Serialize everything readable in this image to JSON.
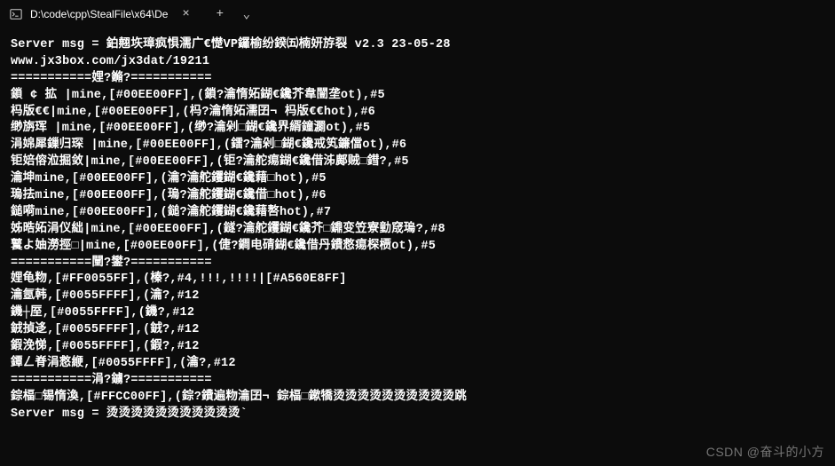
{
  "tab": {
    "title": "D:\\code\\cpp\\StealFile\\x64\\De",
    "close_glyph": "×",
    "add_glyph": "+",
    "dropdown_glyph": "⌄"
  },
  "terminal": {
    "lines": [
      "Server msg = 鉑翹垁璋疯惧濡广€憷VP鑼榆纷鍨㈤楠妍斿裂 v2.3 23-05-28",
      "www.jx3box.com/jx3dat/19211",
      "===========娌?鏅?===========",
      "鎖 ¢ 拡 |mine,[#00EE00FF],(鎖?瀹惰妬鍸€鑱芥韋闓垄ot),#5",
      "杩版€€|mine,[#00EE00FF],(杩?瀹惰妬濡囝¬ 杩版€€hot),#6",
      "缈旃珲 |mine,[#00EE00FF],(缈?瀹剁□鍸€鑱界縃鐘瀱ot),#5",
      "涓婂犀鏁归琛 |mine,[#00EE00FF],(鐳?瀹剁□鍸€鑱戒笂鐮儅ot),#6",
      "钜婄傛涖掘敛|mine,[#00EE00FF],(钜?瀹舵痬鍸€鑱借泲鄺贼□鏏?,#5",
      "瀹坤mine,[#00EE00FF],(瀹?瀹舵钁鍸€鑱藉□hot),#5",
      "瑦抾mine,[#00EE00FF],(瑦?瀹舵钁鍸€鑱借□hot),#6",
      "鎚嗬mine,[#00EE00FF],(鎚?瀹舵钁鍸€鑱藉嗸hot),#7",
      "姊晧妬涓仪絀|mine,[#00EE00FF],(鐩?瀹舵钁鍸€鑱芥□鐤变笠寮勭窚瑦?,#8",
      "鼚よ妯澇挳□|mine,[#00EE00FF],(倢?鐧电碃鍸€鑱借丹鐨慦痬棎槚ot),#5",
      "===========闉?鐢?===========",
      "娌龟粅,[#FF0055FF],(榛?,#4,!!!,!!!!|[#A560E8FF]",
      "瀹氬韩,[#0055FFFF],(瀹?,#12",
      "鐖┼厔,[#0055FFFF],(鐖?,#12",
      "銊揁迻,[#0055FFFF],(銊?,#12",
      "鍜浼悌,[#0055FFFF],(鍜?,#12",
      "鐔ㄥ脊涓慦緶,[#0055FFFF],(瀹?,#12",
      "===========涓?鐪?===========",
      "錝楅□锡惰渙,[#FFCC00FF],(錝?鐨遍粅瀹囝¬ 錝楅□鏉犞烫烫烫烫烫烫烫烫烫烫跳",
      "Server msg = 烫烫烫烫烫烫烫烫烫烫烫`"
    ]
  },
  "watermark": {
    "text": "CSDN @奋斗的小方"
  }
}
